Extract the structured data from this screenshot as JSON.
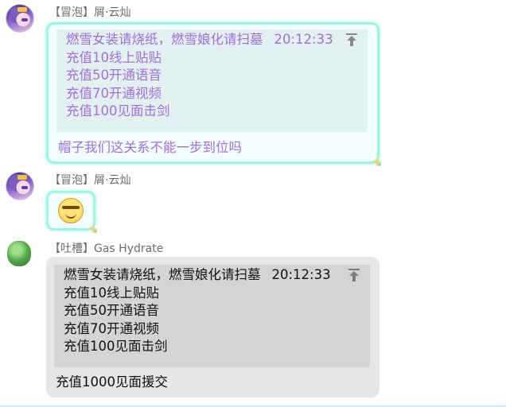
{
  "messages": [
    {
      "sender": "【冒泡】屑·云灿",
      "quote": {
        "first_line": "燃雪女装请烧纸，燃雪娘化请扫墓",
        "time": "20:12:33",
        "lines": [
          "充值10线上贴贴",
          "充值50开通语音",
          "充值70开通视频",
          "充值100见面击剑"
        ]
      },
      "reply": "帽子我们这关系不能一步到位吗"
    },
    {
      "sender": "【冒泡】屑·云灿",
      "emoji": "smile-emoji"
    },
    {
      "sender": "【吐槽】Gas Hydrate",
      "quote": {
        "first_line": "燃雪女装请烧纸，燃雪娘化请扫墓",
        "time": "20:12:33",
        "lines": [
          "充值10线上贴贴",
          "充值50开通语音",
          "充值70开通视频",
          "充值100见面击剑"
        ]
      },
      "reply": "充值1000见面援交"
    }
  ],
  "colors": {
    "fancy_text": "#a16fd8",
    "fancy_border": "#9ff3df",
    "plain_bubble": "#e6e6e6"
  }
}
